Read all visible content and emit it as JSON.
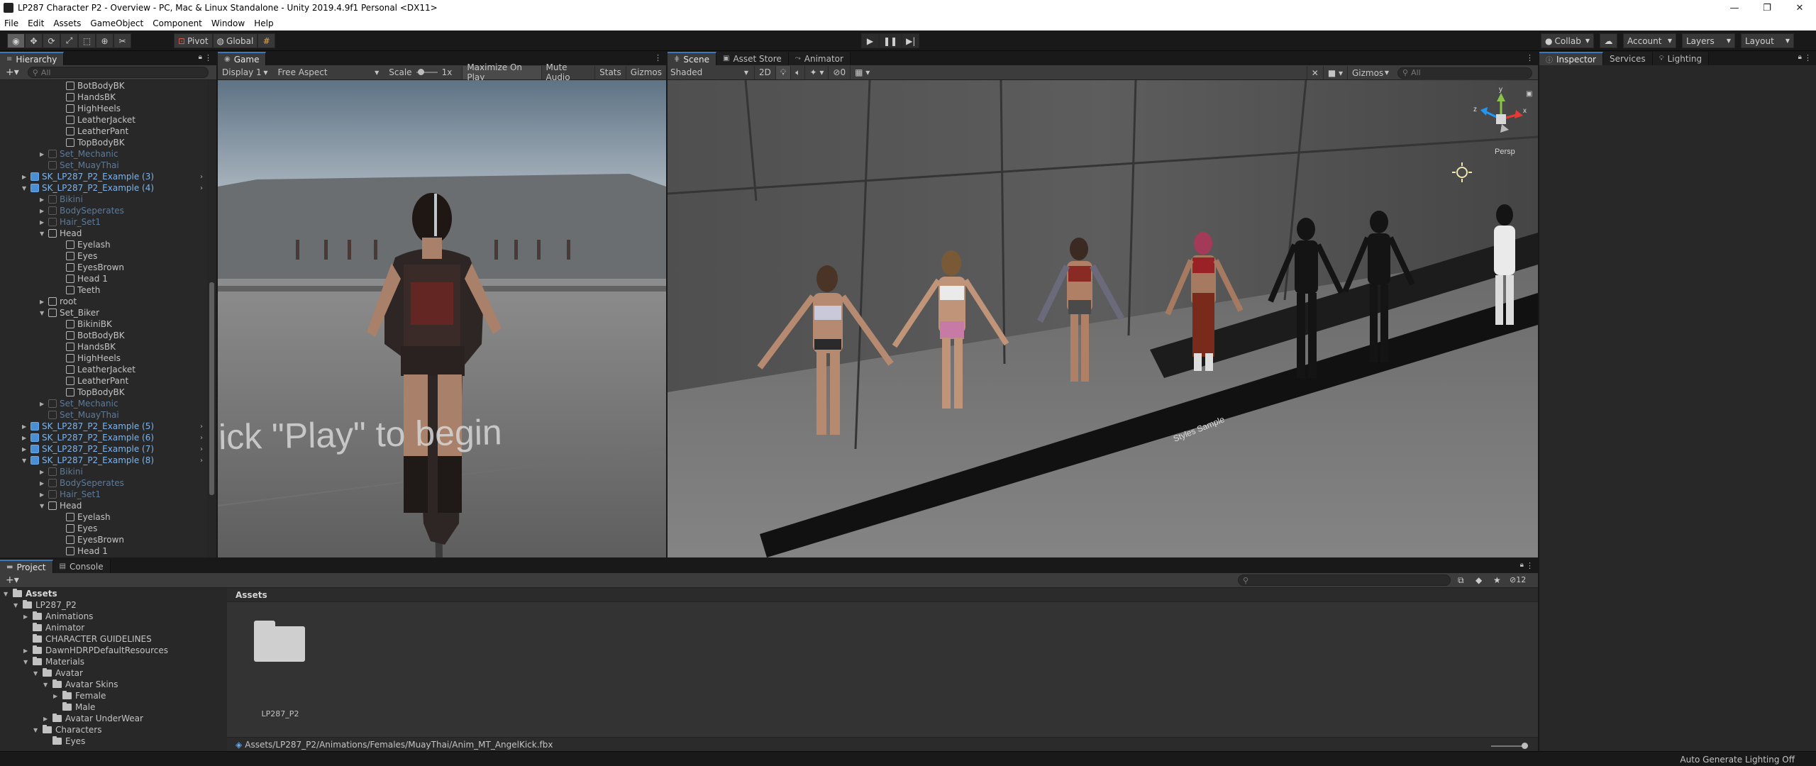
{
  "window": {
    "title": "LP287 Character P2 - Overview - PC, Mac & Linux Standalone - Unity 2019.4.9f1 Personal <DX11>",
    "controls": [
      "—",
      "❐",
      "✕"
    ]
  },
  "menu": [
    "File",
    "Edit",
    "Assets",
    "GameObject",
    "Component",
    "Window",
    "Help"
  ],
  "toolbar": {
    "pivot": "Pivot",
    "global": "Global",
    "collab": "Collab",
    "account": "Account",
    "layers": "Layers",
    "layout": "Layout"
  },
  "hierarchy": {
    "tab": "Hierarchy",
    "search_placeholder": "All",
    "items": [
      {
        "label": "BotBodyBK",
        "depth": 3,
        "state": "normal",
        "expand": ""
      },
      {
        "label": "HandsBK",
        "depth": 3,
        "state": "normal",
        "expand": ""
      },
      {
        "label": "HighHeels",
        "depth": 3,
        "state": "normal",
        "expand": ""
      },
      {
        "label": "LeatherJacket",
        "depth": 3,
        "state": "normal",
        "expand": ""
      },
      {
        "label": "LeatherPant",
        "depth": 3,
        "state": "normal",
        "expand": ""
      },
      {
        "label": "TopBodyBK",
        "depth": 3,
        "state": "normal",
        "expand": ""
      },
      {
        "label": "Set_Mechanic",
        "depth": 2,
        "state": "disabled",
        "expand": "closed"
      },
      {
        "label": "Set_MuayThai",
        "depth": 2,
        "state": "disabled",
        "expand": ""
      },
      {
        "label": "SK_LP287_P2_Example (3)",
        "depth": 1,
        "state": "prefab",
        "expand": "closed"
      },
      {
        "label": "SK_LP287_P2_Example (4)",
        "depth": 1,
        "state": "prefab",
        "expand": "open"
      },
      {
        "label": "Bikini",
        "depth": 2,
        "state": "disabled",
        "expand": "closed"
      },
      {
        "label": "BodySeperates",
        "depth": 2,
        "state": "disabled",
        "expand": "closed"
      },
      {
        "label": "Hair_Set1",
        "depth": 2,
        "state": "disabled",
        "expand": "closed"
      },
      {
        "label": "Head",
        "depth": 2,
        "state": "normal",
        "expand": "open"
      },
      {
        "label": "Eyelash",
        "depth": 3,
        "state": "normal",
        "expand": ""
      },
      {
        "label": "Eyes",
        "depth": 3,
        "state": "normal",
        "expand": ""
      },
      {
        "label": "EyesBrown",
        "depth": 3,
        "state": "normal",
        "expand": ""
      },
      {
        "label": "Head 1",
        "depth": 3,
        "state": "normal",
        "expand": ""
      },
      {
        "label": "Teeth",
        "depth": 3,
        "state": "normal",
        "expand": ""
      },
      {
        "label": "root",
        "depth": 2,
        "state": "normal",
        "expand": "closed"
      },
      {
        "label": "Set_Biker",
        "depth": 2,
        "state": "normal",
        "expand": "open"
      },
      {
        "label": "BikiniBK",
        "depth": 3,
        "state": "normal",
        "expand": ""
      },
      {
        "label": "BotBodyBK",
        "depth": 3,
        "state": "normal",
        "expand": ""
      },
      {
        "label": "HandsBK",
        "depth": 3,
        "state": "normal",
        "expand": ""
      },
      {
        "label": "HighHeels",
        "depth": 3,
        "state": "normal",
        "expand": ""
      },
      {
        "label": "LeatherJacket",
        "depth": 3,
        "state": "normal",
        "expand": ""
      },
      {
        "label": "LeatherPant",
        "depth": 3,
        "state": "normal",
        "expand": ""
      },
      {
        "label": "TopBodyBK",
        "depth": 3,
        "state": "normal",
        "expand": ""
      },
      {
        "label": "Set_Mechanic",
        "depth": 2,
        "state": "disabled",
        "expand": "closed"
      },
      {
        "label": "Set_MuayThai",
        "depth": 2,
        "state": "disabled",
        "expand": ""
      },
      {
        "label": "SK_LP287_P2_Example (5)",
        "depth": 1,
        "state": "prefab",
        "expand": "closed"
      },
      {
        "label": "SK_LP287_P2_Example (6)",
        "depth": 1,
        "state": "prefab",
        "expand": "closed"
      },
      {
        "label": "SK_LP287_P2_Example (7)",
        "depth": 1,
        "state": "prefab",
        "expand": "closed"
      },
      {
        "label": "SK_LP287_P2_Example (8)",
        "depth": 1,
        "state": "prefab",
        "expand": "open"
      },
      {
        "label": "Bikini",
        "depth": 2,
        "state": "disabled",
        "expand": "closed"
      },
      {
        "label": "BodySeperates",
        "depth": 2,
        "state": "disabled",
        "expand": "closed"
      },
      {
        "label": "Hair_Set1",
        "depth": 2,
        "state": "disabled",
        "expand": "closed"
      },
      {
        "label": "Head",
        "depth": 2,
        "state": "normal",
        "expand": "open"
      },
      {
        "label": "Eyelash",
        "depth": 3,
        "state": "normal",
        "expand": ""
      },
      {
        "label": "Eyes",
        "depth": 3,
        "state": "normal",
        "expand": ""
      },
      {
        "label": "EyesBrown",
        "depth": 3,
        "state": "normal",
        "expand": ""
      },
      {
        "label": "Head 1",
        "depth": 3,
        "state": "normal",
        "expand": ""
      }
    ]
  },
  "game": {
    "tab": "Game",
    "display": "Display 1",
    "aspect": "Free Aspect",
    "scale_label": "Scale",
    "scale_value": "1x",
    "maximize": "Maximize On Play",
    "mute": "Mute Audio",
    "stats": "Stats",
    "gizmos": "Gizmos",
    "overlay_text": "lick \"Play\" to begin"
  },
  "scene": {
    "tabs": [
      "Scene",
      "Asset Store",
      "Animator"
    ],
    "shading": "Shaded",
    "mode_2d": "2D",
    "hidden_count": "0",
    "gizmos": "Gizmos",
    "search_placeholder": "All",
    "persp": "Persp",
    "axis_y": "y",
    "axis_x": "x",
    "axis_z": "z",
    "floor_label": "Styles Sample"
  },
  "inspector": {
    "tabs": [
      "Inspector",
      "Services",
      "Lighting"
    ]
  },
  "project": {
    "tabs": [
      "Project",
      "Console"
    ],
    "hidden_packages": "12",
    "tree": [
      {
        "label": "Assets",
        "depth": 0,
        "expand": "open",
        "bold": true
      },
      {
        "label": "LP287_P2",
        "depth": 1,
        "expand": "open",
        "bold": false
      },
      {
        "label": "Animations",
        "depth": 2,
        "expand": "closed",
        "bold": false
      },
      {
        "label": "Animator",
        "depth": 2,
        "expand": "",
        "bold": false
      },
      {
        "label": "CHARACTER GUIDELINES",
        "depth": 2,
        "expand": "",
        "bold": false
      },
      {
        "label": "DawnHDRPDefaultResources",
        "depth": 2,
        "expand": "closed",
        "bold": false
      },
      {
        "label": "Materials",
        "depth": 2,
        "expand": "open",
        "bold": false
      },
      {
        "label": "Avatar",
        "depth": 3,
        "expand": "open",
        "bold": false
      },
      {
        "label": "Avatar Skins",
        "depth": 4,
        "expand": "open",
        "bold": false
      },
      {
        "label": "Female",
        "depth": 5,
        "expand": "closed",
        "bold": false
      },
      {
        "label": "Male",
        "depth": 5,
        "expand": "",
        "bold": false
      },
      {
        "label": "Avatar UnderWear",
        "depth": 4,
        "expand": "closed",
        "bold": false
      },
      {
        "label": "Characters",
        "depth": 3,
        "expand": "open",
        "bold": false
      },
      {
        "label": "Eyes",
        "depth": 4,
        "expand": "",
        "bold": false
      }
    ],
    "breadcrumb": "Assets",
    "folder_label": "LP287_P2",
    "selected_path": "Assets/LP287_P2/Animations/Females/MuayThai/Anim_MT_AngelKick.fbx"
  },
  "status": {
    "lighting": "Auto Generate Lighting Off"
  },
  "colors": {
    "accent": "#3a79bb",
    "prefab_text": "#7fb3e8",
    "disabled_text": "#5f7a98"
  }
}
